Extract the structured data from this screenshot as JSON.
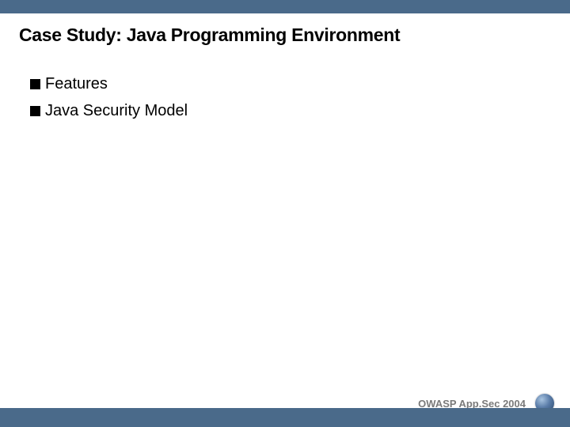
{
  "slide": {
    "title": "Case Study: Java Programming Environment",
    "bullets": [
      {
        "text": "Features"
      },
      {
        "text": "Java Security Model"
      }
    ]
  },
  "footer": {
    "label": "OWASP App.Sec 2004",
    "logo_name": "globe-logo"
  },
  "colors": {
    "bar": "#4a6a8a",
    "footer_text": "#7a7a7a"
  }
}
